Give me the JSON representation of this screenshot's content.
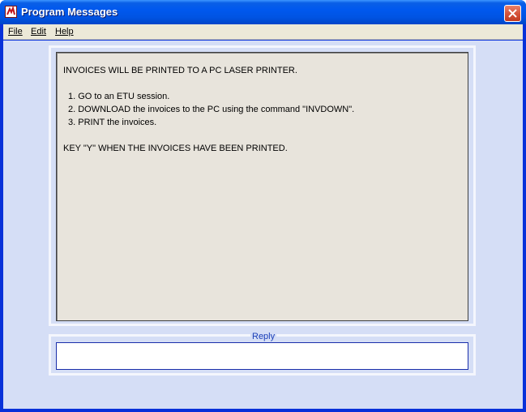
{
  "window": {
    "title": "Program Messages",
    "icon": "app-icon",
    "close_icon": "close-icon"
  },
  "menu": {
    "file": "File",
    "edit": "Edit",
    "help": "Help"
  },
  "message": {
    "lines": [
      "INVOICES WILL BE PRINTED TO A PC LASER PRINTER.",
      "1. GO to an ETU session.",
      "2. DOWNLOAD the invoices to the PC using the command \"INVDOWN\".",
      "3. PRINT the invoices.",
      "KEY \"Y\" WHEN THE INVOICES HAVE BEEN PRINTED."
    ]
  },
  "reply": {
    "label": "Reply",
    "value": ""
  },
  "colors": {
    "titlebar": "#0054e3",
    "client_background": "#d5def6",
    "message_background": "#e8e4dc",
    "reply_label": "#1a3fb8"
  }
}
